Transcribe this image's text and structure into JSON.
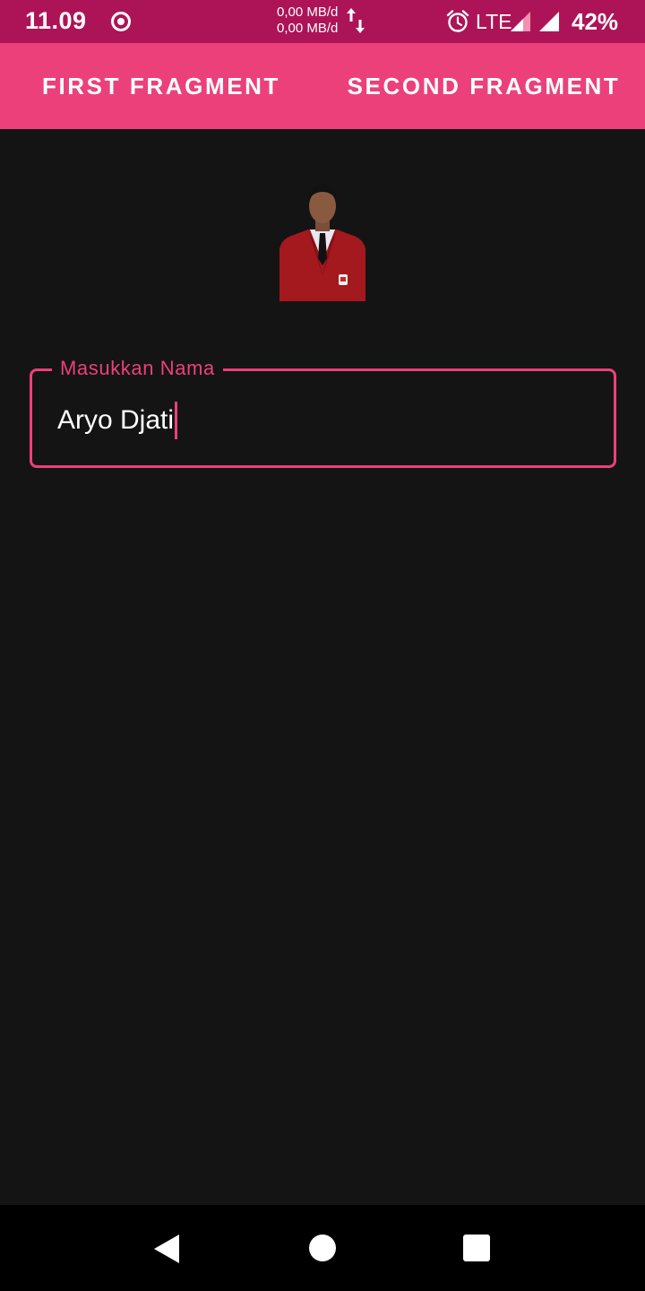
{
  "status_bar": {
    "time": "11.09",
    "net_up": "0,00 MB/d",
    "net_down": "0,00 MB/d",
    "network_type": "LTE",
    "battery": "42%",
    "icons": [
      "record-icon",
      "data-arrows-icon",
      "alarm-icon",
      "signal-icon",
      "signal-icon"
    ]
  },
  "tabs": [
    {
      "label": "FIRST FRAGMENT"
    },
    {
      "label": "SECOND FRAGMENT"
    }
  ],
  "form": {
    "name_label": "Masukkan Nama",
    "name_value": "Aryo Djati"
  },
  "nav_bar": {
    "icons": [
      "back-icon",
      "home-icon",
      "recents-icon"
    ]
  },
  "colors": {
    "status_bar": "#ad1457",
    "accent": "#ec407a",
    "background": "#141414",
    "nav_bar": "#000000"
  }
}
